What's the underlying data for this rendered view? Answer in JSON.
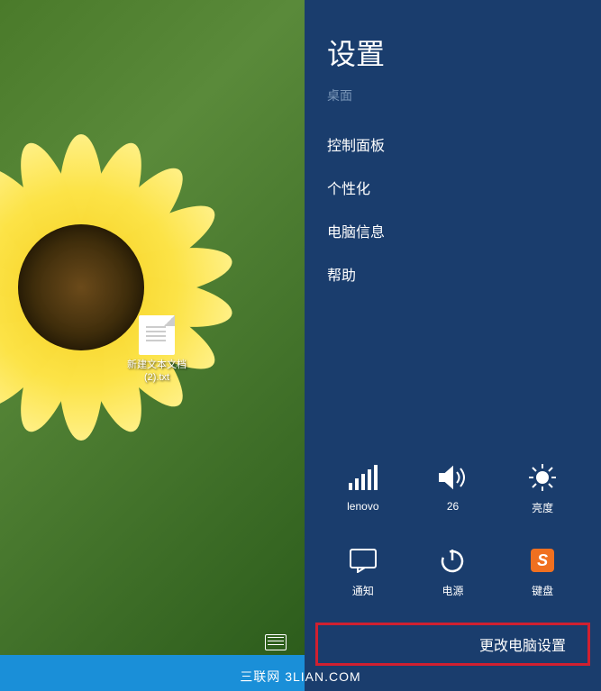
{
  "panel": {
    "title": "设置",
    "subtitle": "桌面",
    "menu_items": [
      "控制面板",
      "个性化",
      "电脑信息",
      "帮助"
    ]
  },
  "tiles": {
    "network": {
      "label": "lenovo"
    },
    "volume": {
      "label": "26"
    },
    "brightness": {
      "label": "亮度"
    },
    "notifications": {
      "label": "通知"
    },
    "power": {
      "label": "电源"
    },
    "keyboard": {
      "label": "键盘"
    }
  },
  "change_settings": "更改电脑设置",
  "desktop": {
    "file_label": "新建文本文档 (2).txt"
  },
  "watermark": "三联网 3LIAN.COM"
}
